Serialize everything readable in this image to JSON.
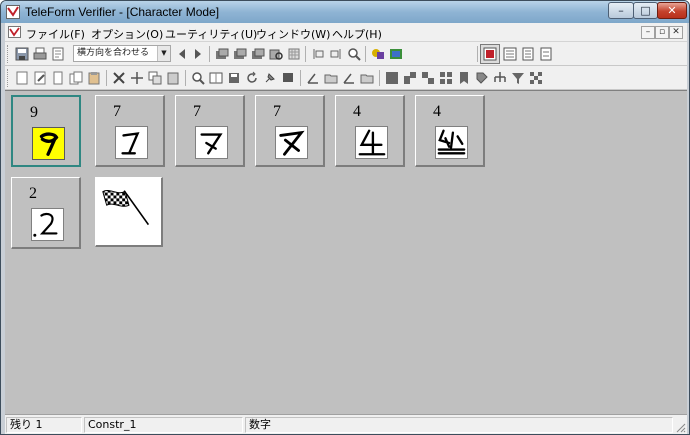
{
  "window": {
    "title": "TeleForm Verifier - [Character Mode]",
    "controls": {
      "minimize": "–",
      "maximize": "□",
      "close": "✕"
    }
  },
  "menu": {
    "items": [
      "ファイル(F)",
      "オプション(O)",
      "ユーティリティ(U)",
      "ウィンドウ(W)",
      "ヘルプ(H)"
    ],
    "mdi": [
      "–",
      "▫",
      "✕"
    ]
  },
  "toolbar": {
    "zoom_combo": "横方向を合わせる"
  },
  "characters": [
    {
      "label": "9",
      "selected": true
    },
    {
      "label": "7",
      "selected": false
    },
    {
      "label": "7",
      "selected": false
    },
    {
      "label": "7",
      "selected": false
    },
    {
      "label": "4",
      "selected": false
    },
    {
      "label": "4",
      "selected": false
    },
    {
      "label": "2",
      "selected": false
    }
  ],
  "status": {
    "remaining": "残り 1",
    "constraint": "Constr_1",
    "type": "数字"
  },
  "colors": {
    "highlight": "#ffff00",
    "selection_border": "#2f8782",
    "workspace": "#c0c0c0"
  }
}
